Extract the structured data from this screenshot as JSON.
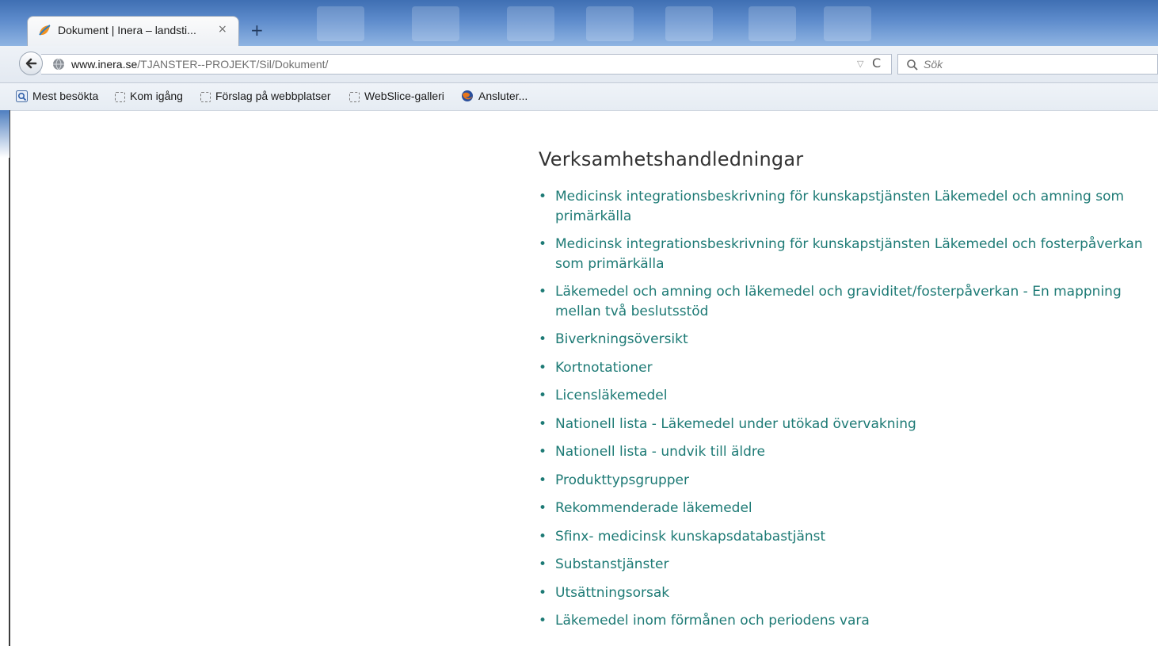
{
  "browser": {
    "tab": {
      "title": "Dokument | Inera – landsti...",
      "close": "×"
    },
    "new_tab": "+",
    "url": {
      "host": "www.inera.se",
      "path": "/TJANSTER--PROJEKT/Sil/Dokument/"
    },
    "url_dropdown": "▽",
    "reload": "C",
    "search": {
      "placeholder": "Sök"
    },
    "bookmarks": [
      {
        "label": "Mest besökta",
        "icon": "most-visited-icon"
      },
      {
        "label": "Kom igång",
        "icon": "page-icon"
      },
      {
        "label": "Förslag på webbplatser",
        "icon": "page-icon"
      },
      {
        "label": "WebSlice-galleri",
        "icon": "page-icon"
      },
      {
        "label": "Ansluter...",
        "icon": "firefox-icon"
      }
    ]
  },
  "page": {
    "heading": "Verksamhetshandledningar",
    "documents": [
      "Medicinsk integrationsbeskrivning för kunskapstjänsten Läkemedel och amning som primärkälla",
      "Medicinsk integrationsbeskrivning för kunskapstjänsten Läkemedel och fosterpåverkan som primärkälla",
      "Läkemedel och amning och läkemedel och graviditet/fosterpåverkan - En mappning mellan två beslutsstöd",
      "Biverkningsöversikt",
      "Kortnotationer",
      "Licensläkemedel",
      "Nationell lista - Läkemedel under utökad övervakning",
      "Nationell lista - undvik till äldre",
      "Produkttypsgrupper",
      "Rekommenderade läkemedel",
      "Sfinx- medicinsk kunskapsdatabastjänst",
      "Substanstjänster",
      "Utsättningsorsak",
      "Läkemedel inom förmånen och periodens vara"
    ],
    "bullet": "•"
  },
  "colors": {
    "link": "#1d7a75",
    "heading": "#333333"
  }
}
